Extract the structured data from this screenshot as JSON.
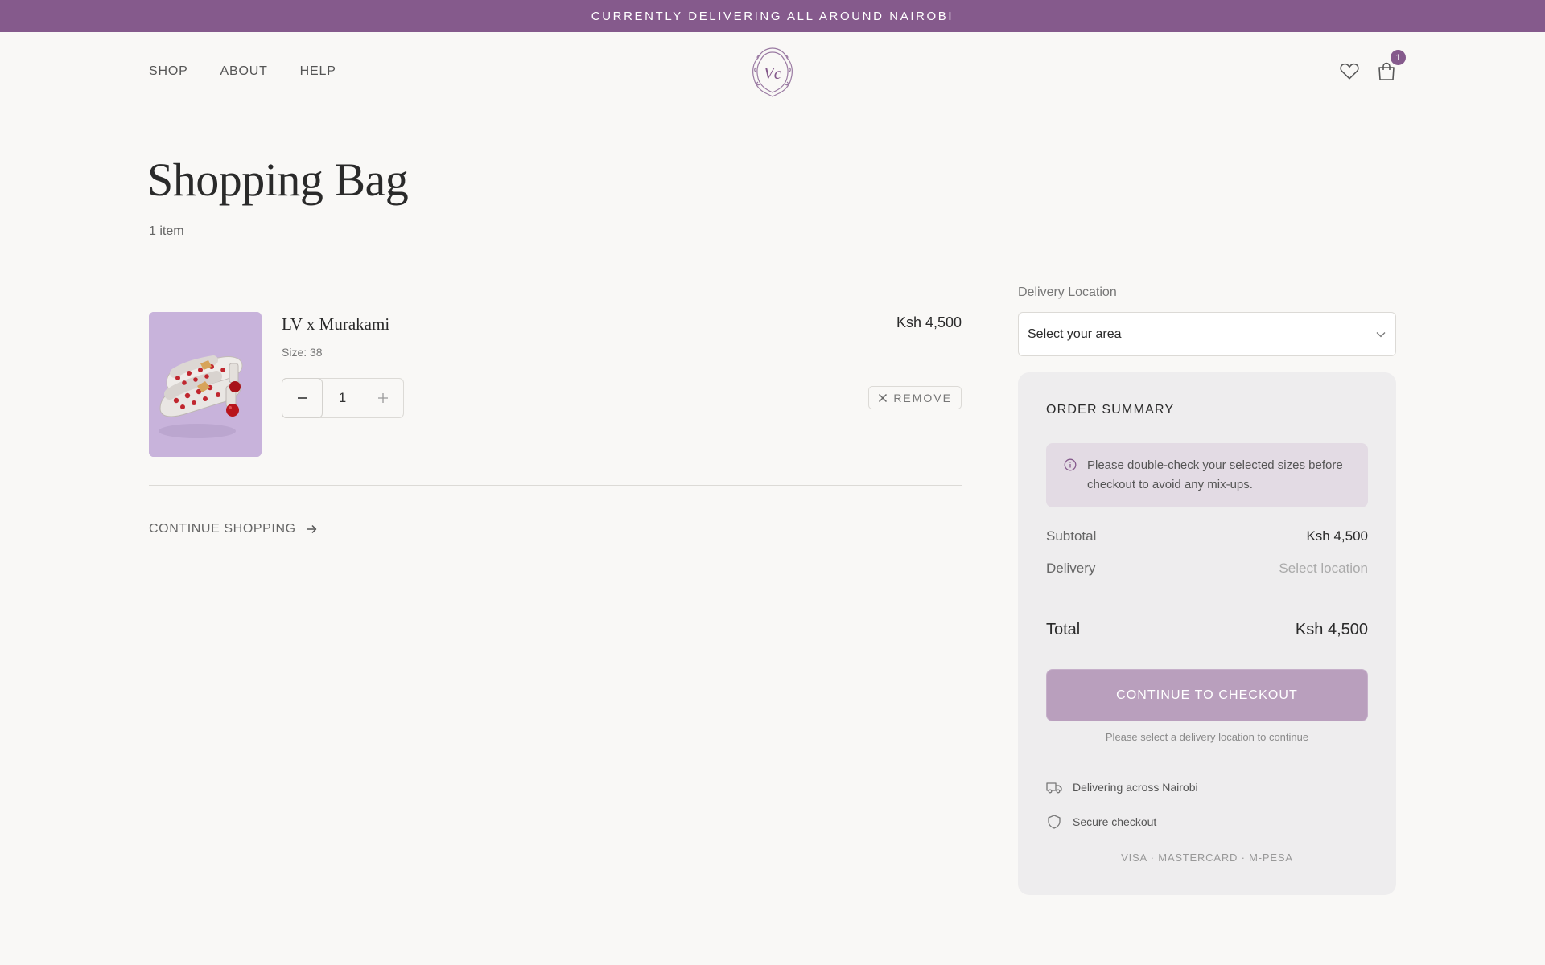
{
  "announcement": "CURRENTLY DELIVERING ALL AROUND NAIROBI",
  "nav": {
    "shop": "SHOP",
    "about": "ABOUT",
    "help": "HELP"
  },
  "header": {
    "cart_count": "1",
    "accent_color": "#855a8c"
  },
  "page": {
    "title": "Shopping Bag",
    "item_count": "1 item"
  },
  "cart": {
    "items": [
      {
        "name": "LV x Murakami",
        "size": "Size: 38",
        "price": "Ksh 4,500",
        "quantity": "1",
        "remove_label": "REMOVE"
      }
    ],
    "continue_shopping": "CONTINUE SHOPPING"
  },
  "delivery": {
    "label": "Delivery Location",
    "select_value": "Select your area"
  },
  "summary": {
    "title": "ORDER SUMMARY",
    "notice": "Please double-check your selected sizes before checkout to avoid any mix-ups.",
    "subtotal_label": "Subtotal",
    "subtotal_value": "Ksh 4,500",
    "delivery_label": "Delivery",
    "delivery_value": "Select location",
    "total_label": "Total",
    "total_value": "Ksh 4,500",
    "checkout_label": "CONTINUE TO CHECKOUT",
    "checkout_hint": "Please select a delivery location to continue",
    "perk_delivery": "Delivering across Nairobi",
    "perk_secure": "Secure checkout",
    "payment_methods": "VISA · MASTERCARD · M-PESA"
  },
  "icons": {
    "wishlist": "heart-icon",
    "cart": "shopping-bag-icon",
    "logo": "vc-monogram-crest",
    "minus": "minus-icon",
    "plus": "plus-icon",
    "remove": "x-icon",
    "arrow": "arrow-right-icon",
    "dropdown": "chevron-down-icon",
    "info": "info-icon",
    "truck": "truck-icon",
    "shield": "shield-icon"
  }
}
